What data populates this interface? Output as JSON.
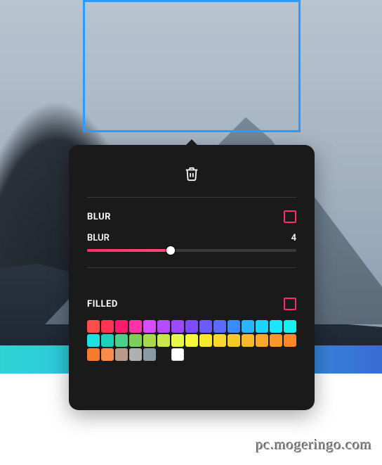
{
  "selection": {
    "border_color": "#2b9cff"
  },
  "toolbar": {
    "delete_icon": "trash"
  },
  "sections": {
    "blur": {
      "label": "BLUR",
      "checkbox_color": "#ff2d6b",
      "slider": {
        "label": "BLUR",
        "value": 4,
        "min": 0,
        "max": 10
      }
    },
    "filled": {
      "label": "FILLED",
      "checkbox_color": "#ff2d6b"
    }
  },
  "palette": {
    "rows": [
      [
        "#ff4d4d",
        "#ff3355",
        "#ff1a6b",
        "#ff33a3",
        "#d94bff",
        "#b84bff",
        "#9b4bff",
        "#7b4bff",
        "#6b5bff",
        "#5b6bff",
        "#3b8bff",
        "#2bb4ff",
        "#1bd4ff",
        "#1be4ff",
        "#1af0f0"
      ],
      [
        "#1de0e0",
        "#1dd0b8",
        "#4bd08b",
        "#7bd05b",
        "#a8d84b",
        "#c8e84b",
        "#e8f84b",
        "#f8f83b",
        "#f8e82b",
        "#f8d82b",
        "#f8c82b",
        "#f8b82b",
        "#f8a82b",
        "#f8982b",
        "#f8882b"
      ],
      [
        "#f87a2b",
        "#f88a4b",
        "#b89a8b",
        "#b0b0b0",
        "#8a9aa5",
        "#1a1a1a",
        "#ffffff"
      ]
    ]
  },
  "watermark": "pc.mogeringo.com",
  "colors": {
    "panel_bg": "#1a1a1a",
    "accent": "#ff2d6b"
  }
}
